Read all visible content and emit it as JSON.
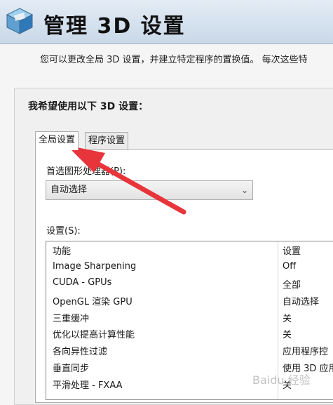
{
  "header": {
    "title": "管理 3D 设置"
  },
  "description": "您可以更改全局 3D 设置，并建立特定程序的置换值。 每次这些特",
  "section_title": "我希望使用以下 3D 设置：",
  "tabs": [
    {
      "label": "全局设置",
      "active": true
    },
    {
      "label": "程序设置",
      "active": false
    }
  ],
  "preferred_processor": {
    "label": "首选图形处理器(P):",
    "value": "自动选择"
  },
  "settings": {
    "label": "设置(S):",
    "headers": {
      "feature": "功能",
      "setting": "设置"
    },
    "rows": [
      {
        "feature": "Image Sharpening",
        "setting": "Off"
      },
      {
        "feature": "CUDA - GPUs",
        "setting": "全部"
      },
      {
        "feature": "OpenGL 渲染 GPU",
        "setting": "自动选择"
      },
      {
        "feature": "三重缓冲",
        "setting": "关"
      },
      {
        "feature": "优化以提高计算性能",
        "setting": "关"
      },
      {
        "feature": "各向异性过滤",
        "setting": "应用程序控"
      },
      {
        "feature": "垂直同步",
        "setting": "使用 3D 应用"
      },
      {
        "feature": "平滑处理 - FXAA",
        "setting": "关"
      }
    ]
  },
  "colors": {
    "arrow": "#e8343b",
    "header_bg": "#d3e0ed"
  },
  "watermark": "Baidu 经验",
  "icons": {
    "logo": "3d-cube-icon",
    "dropdown": "chevron-down-icon",
    "annotation": "red-arrow-icon"
  }
}
